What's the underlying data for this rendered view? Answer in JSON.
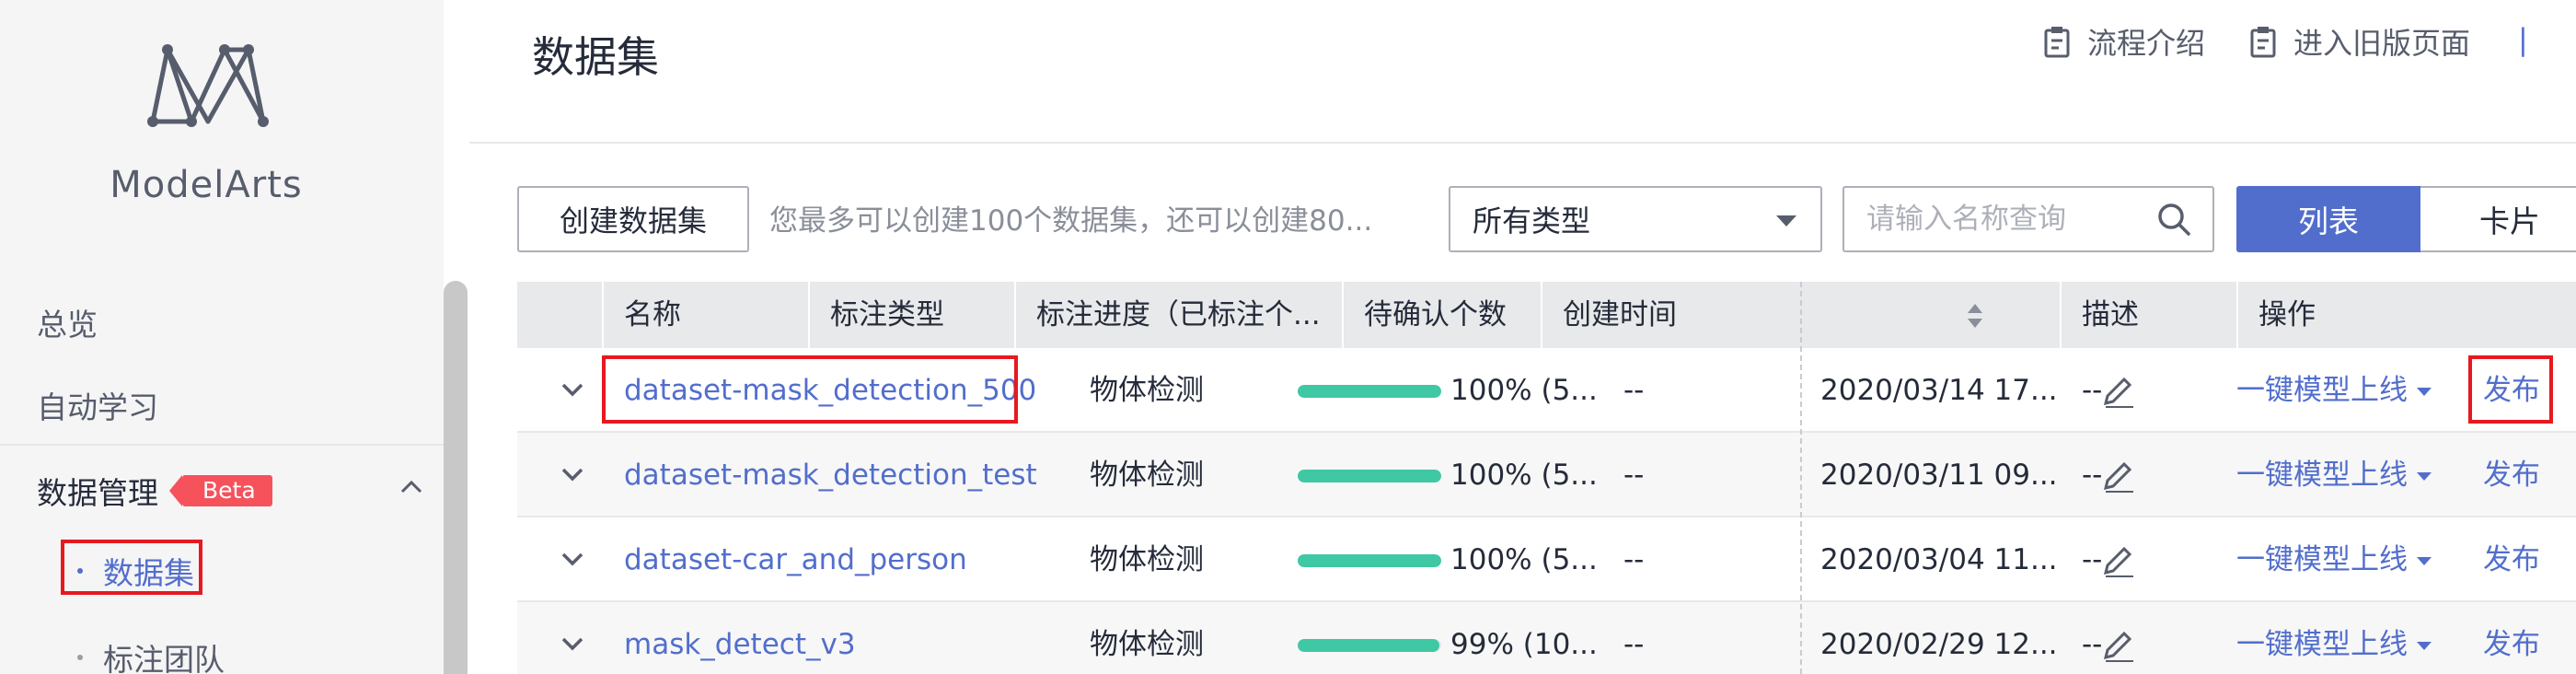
{
  "sidebar": {
    "brand": "ModelArts",
    "items": [
      {
        "label": "总览"
      },
      {
        "label": "自动学习"
      }
    ],
    "group": {
      "label": "数据管理",
      "badge": "Beta"
    },
    "sub_items": [
      {
        "label": "数据集",
        "active": true
      },
      {
        "label": "标注团队",
        "active": false
      }
    ]
  },
  "header": {
    "title": "数据集",
    "links": [
      {
        "label": "流程介绍",
        "icon": "clipboard-icon"
      },
      {
        "label": "进入旧版页面",
        "icon": "clipboard-icon"
      }
    ],
    "separator": "|"
  },
  "toolbar": {
    "create_label": "创建数据集",
    "tip": "您最多可以创建100个数据集，还可以创建80...",
    "type_select": {
      "selected": "所有类型"
    },
    "search": {
      "placeholder": "请输入名称查询",
      "value": ""
    },
    "views": {
      "list": "列表",
      "card": "卡片",
      "active": "list"
    }
  },
  "table": {
    "headers": {
      "name": "名称",
      "label_type": "标注类型",
      "progress": "标注进度（已标注个...",
      "pending": "待确认个数",
      "created": "创建时间",
      "desc": "描述",
      "actions": "操作"
    },
    "rows": [
      {
        "name": "dataset-mask_detection_500",
        "label_type": "物体检测",
        "progress": 1.0,
        "progress_text": "100% (5...",
        "pending": "--",
        "created": "2020/03/14 17...",
        "desc": "--",
        "deploy": "一键模型上线",
        "publish": "发布"
      },
      {
        "name": "dataset-mask_detection_test",
        "label_type": "物体检测",
        "progress": 1.0,
        "progress_text": "100% (5...",
        "pending": "--",
        "created": "2020/03/11 09...",
        "desc": "--",
        "deploy": "一键模型上线",
        "publish": "发布"
      },
      {
        "name": "dataset-car_and_person",
        "label_type": "物体检测",
        "progress": 1.0,
        "progress_text": "100% (5...",
        "pending": "--",
        "created": "2020/03/04 11...",
        "desc": "--",
        "deploy": "一键模型上线",
        "publish": "发布"
      },
      {
        "name": "mask_detect_v3",
        "label_type": "物体检测",
        "progress": 0.99,
        "progress_text": "99% (10...",
        "pending": "--",
        "created": "2020/02/29 12...",
        "desc": "--",
        "deploy": "一键模型上线",
        "publish": "发布"
      }
    ]
  },
  "colors": {
    "accent": "#526ecc",
    "progress": "#3fc8a3",
    "highlight": "#e6191f",
    "beta": "#f5525c"
  }
}
